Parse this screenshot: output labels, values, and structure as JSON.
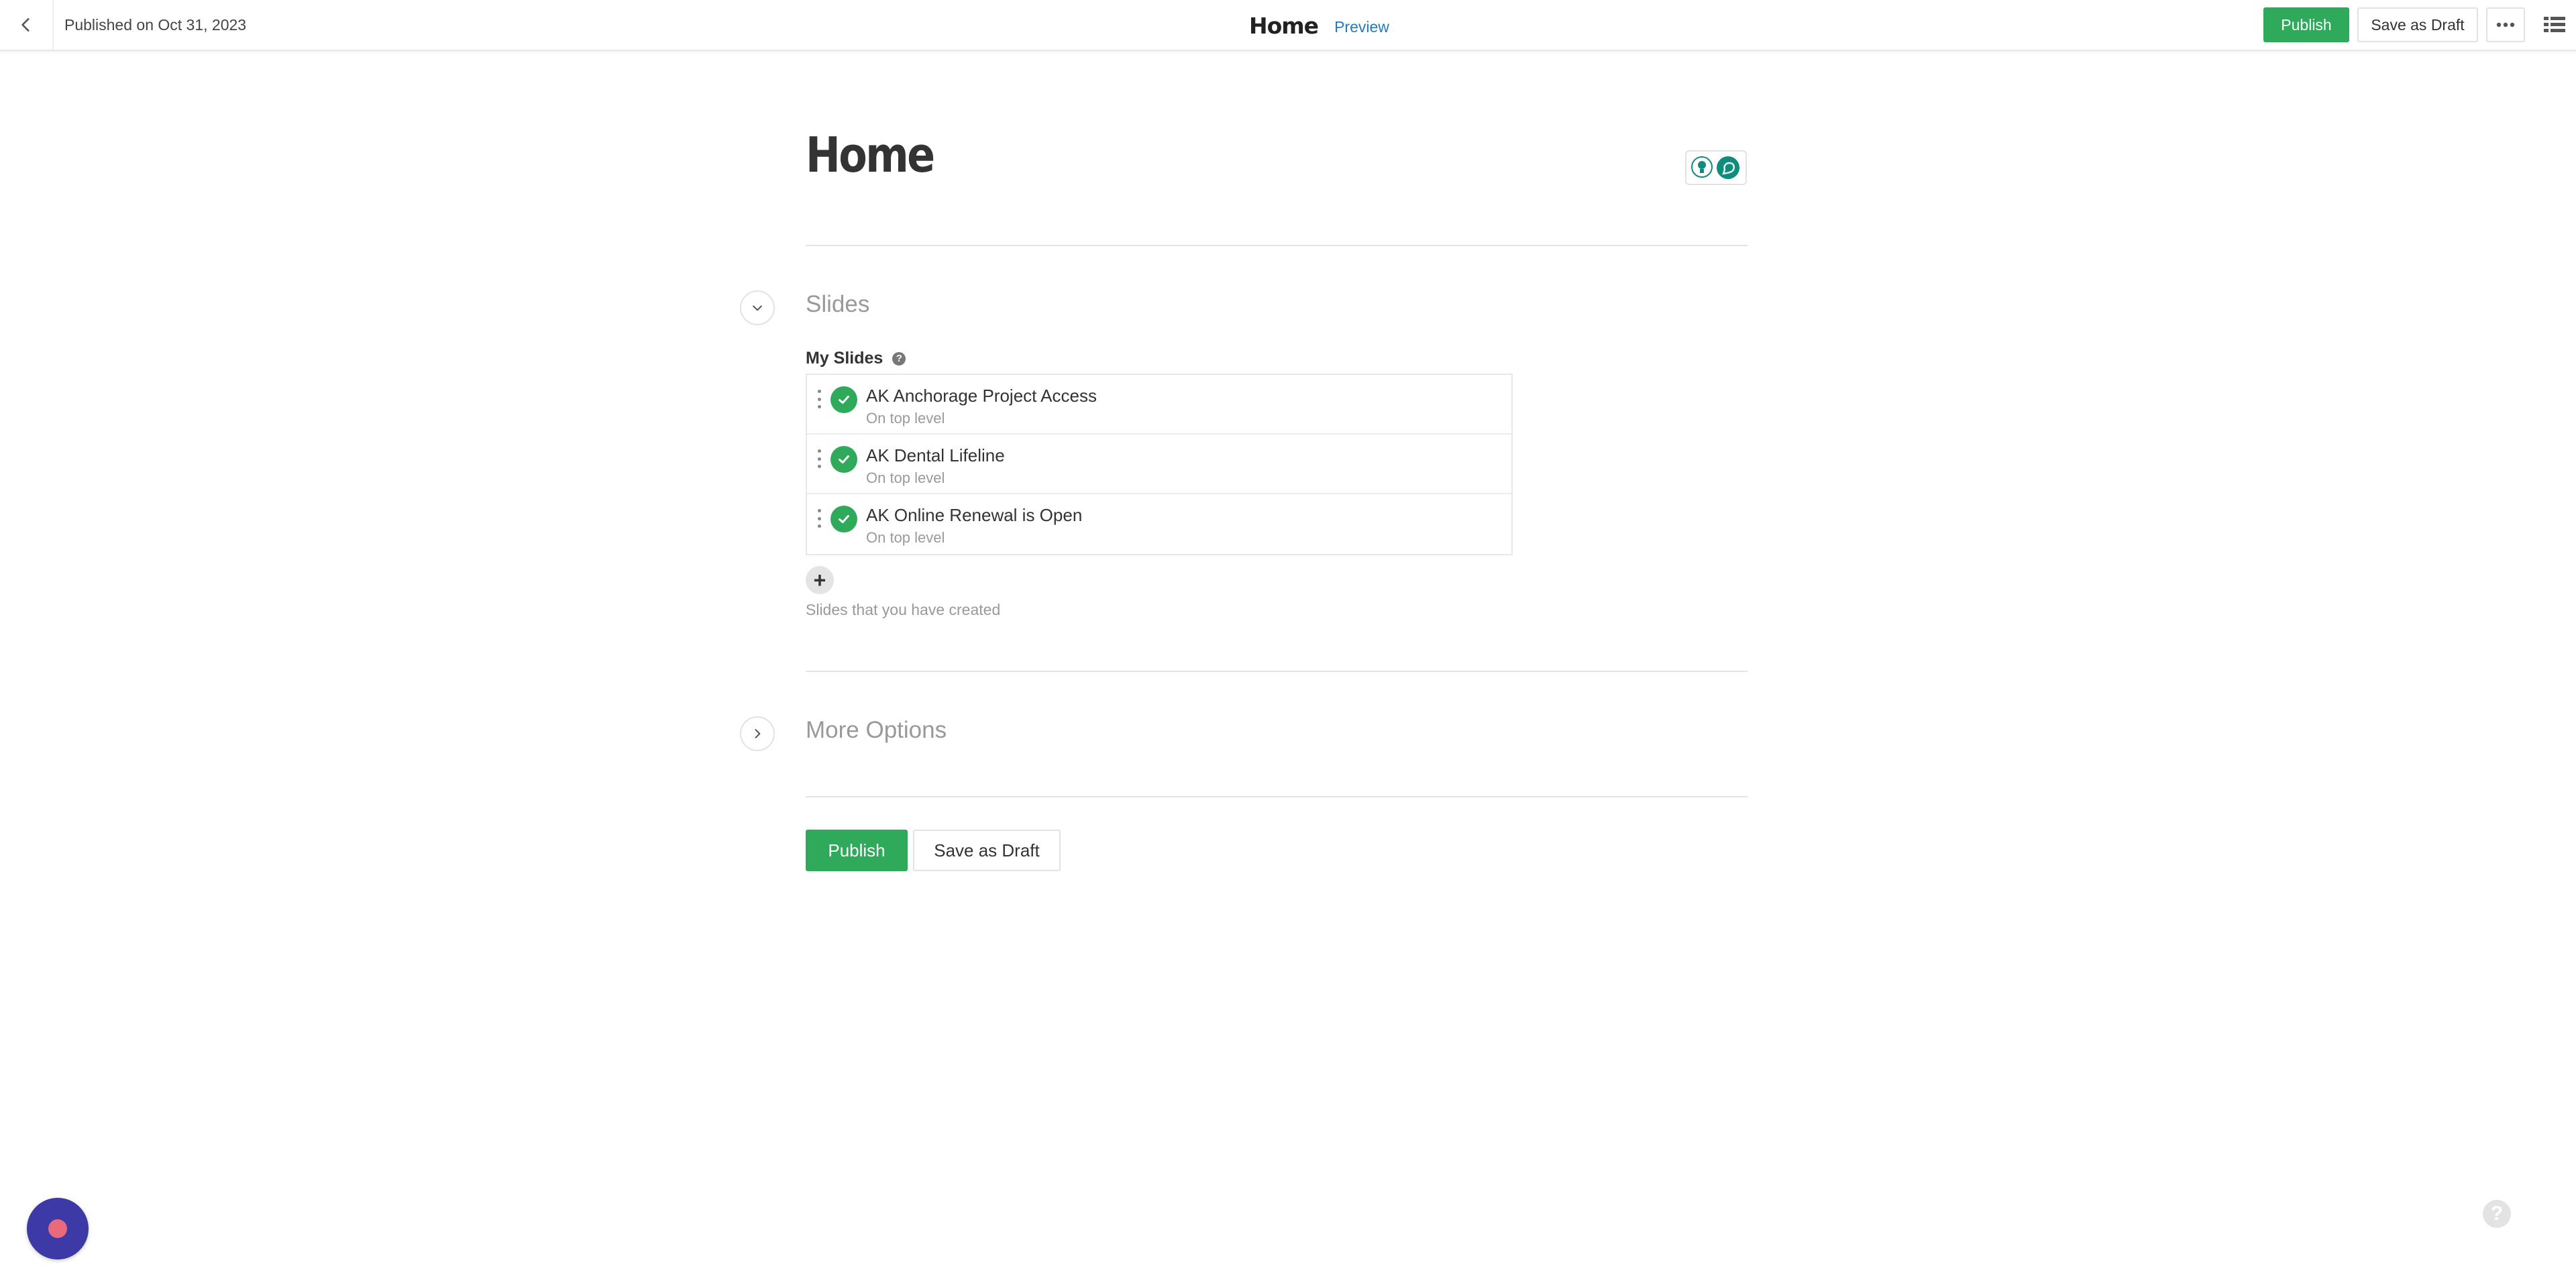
{
  "header": {
    "back_icon": "chevron-left-icon",
    "published_text": "Published on Oct 31, 2023",
    "title": "Home",
    "preview_label": "Preview",
    "publish_label": "Publish",
    "save_draft_label": "Save as Draft",
    "more_icon": "ellipsis-icon",
    "layout_icon": "list-layout-icon"
  },
  "page": {
    "title": "Home",
    "collaborators_icon": "collaborator-avatars-icon"
  },
  "slides_section": {
    "title": "Slides",
    "toggle_icon": "chevron-down-icon",
    "field_label": "My Slides",
    "help_icon": "question-icon",
    "items": [
      {
        "name": "AK Anchorage Project Access",
        "sub": "On top level",
        "status_icon": "check-icon"
      },
      {
        "name": "AK Dental Lifeline",
        "sub": "On top level",
        "status_icon": "check-icon"
      },
      {
        "name": "AK Online Renewal is Open",
        "sub": "On top level",
        "status_icon": "check-icon"
      }
    ],
    "add_label": "+",
    "hint": "Slides that you have created"
  },
  "more_options": {
    "title": "More Options",
    "toggle_icon": "chevron-right-icon"
  },
  "footer_actions": {
    "publish_label": "Publish",
    "save_draft_label": "Save as Draft"
  },
  "floating": {
    "chat_icon": "chat-launcher-icon",
    "help_label": "?"
  },
  "colors": {
    "primary_green": "#2eaa5a",
    "link_blue": "#1f7bc1",
    "launcher_purple": "#3d3aa8",
    "launcher_dot": "#e96a7c",
    "teal_avatar": "#0f8c7c"
  }
}
